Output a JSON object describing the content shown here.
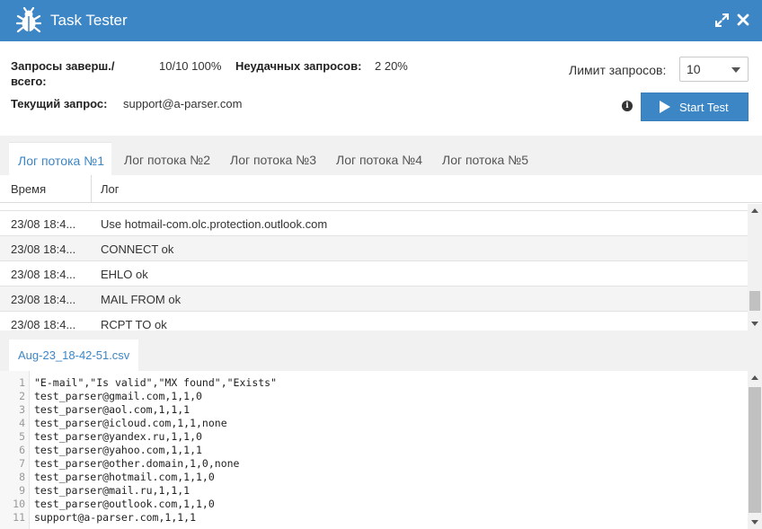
{
  "window": {
    "title": "Task Tester"
  },
  "stats": {
    "completed_label_line1": "Запросы заверш./",
    "completed_label_line2": "всего:",
    "completed_value": "10/10 100%",
    "failed_label": "Неудачных запросов:",
    "failed_value": "2 20%",
    "current_label": "Текущий запрос:",
    "current_value": "support@a-parser.com",
    "limit_label": "Лимит запросов:",
    "limit_value": "10",
    "start_label": "Start Test"
  },
  "tabs": [
    {
      "label": "Лог потока №1",
      "active": true
    },
    {
      "label": "Лог потока №2",
      "active": false
    },
    {
      "label": "Лог потока №3",
      "active": false
    },
    {
      "label": "Лог потока №4",
      "active": false
    },
    {
      "label": "Лог потока №5",
      "active": false
    }
  ],
  "log": {
    "col_time": "Время",
    "col_log": "Лог",
    "rows": [
      {
        "time": "23/08 18:4...",
        "msg": "Use hotmail-com.olc.protection.outlook.com"
      },
      {
        "time": "23/08 18:4...",
        "msg": "CONNECT ok"
      },
      {
        "time": "23/08 18:4...",
        "msg": "EHLO ok"
      },
      {
        "time": "23/08 18:4...",
        "msg": "MAIL FROM ok"
      },
      {
        "time": "23/08 18:4...",
        "msg": "RCPT TO ok"
      }
    ]
  },
  "result": {
    "file_tab": "Aug-23_18-42-51.csv",
    "lines": [
      "\"E-mail\",\"Is valid\",\"MX found\",\"Exists\"",
      "test_parser@gmail.com,1,1,0",
      "test_parser@aol.com,1,1,1",
      "test_parser@icloud.com,1,1,none",
      "test_parser@yandex.ru,1,1,0",
      "test_parser@yahoo.com,1,1,1",
      "test_parser@other.domain,1,0,none",
      "test_parser@hotmail.com,1,1,0",
      "test_parser@mail.ru,1,1,1",
      "test_parser@outlook.com,1,1,0",
      "support@a-parser.com,1,1,1"
    ],
    "line_numbers": [
      "1",
      "2",
      "3",
      "4",
      "5",
      "6",
      "7",
      "8",
      "9",
      "10",
      "11"
    ]
  },
  "colors": {
    "accent": "#3d86c6",
    "tab_bg": "#f1f1f1"
  },
  "icons": {
    "app": "bug-icon",
    "expand": "expand-icon",
    "close": "close-icon",
    "info": "info-icon",
    "play": "play-icon"
  }
}
